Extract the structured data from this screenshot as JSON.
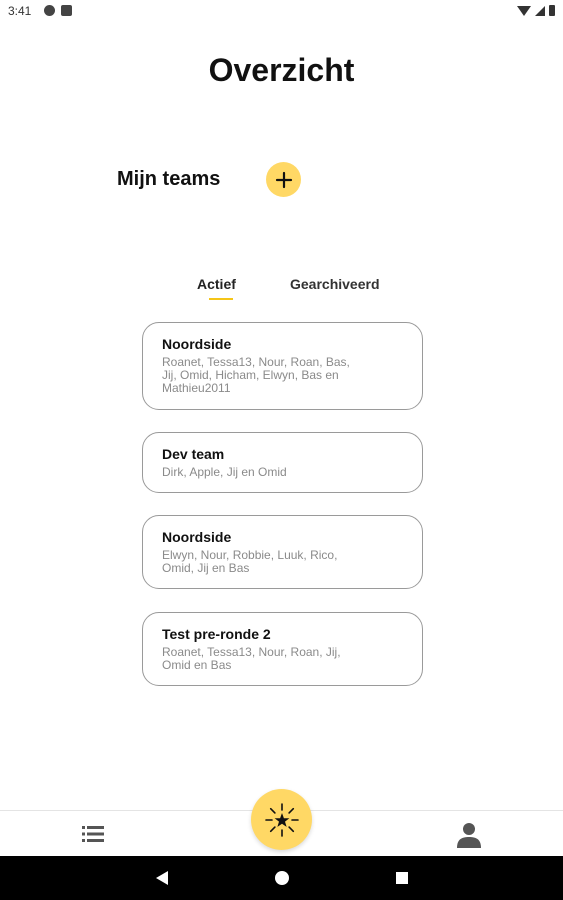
{
  "status_bar": {
    "time": "3:41",
    "left_icons": [
      "notification-icon",
      "sd-card-icon"
    ],
    "right_icons": [
      "wifi-icon",
      "signal-icon",
      "battery-icon"
    ]
  },
  "page": {
    "title": "Overzicht"
  },
  "teams": {
    "heading": "Mijn teams",
    "add_icon": "plus-icon"
  },
  "tabs": [
    {
      "label": "Actief",
      "selected": true
    },
    {
      "label": "Gearchiveerd",
      "selected": false
    }
  ],
  "team_cards": [
    {
      "name": "Noordside",
      "members": [
        "Roanet, Tessa13, Nour, Roan, Bas,",
        "Jij, Omid, Hicham, Elwyn, Bas en",
        "Mathieu2011"
      ]
    },
    {
      "name": "Dev team",
      "members": [
        "Dirk, Apple, Jij en Omid"
      ]
    },
    {
      "name": "Noordside",
      "members": [
        "Elwyn, Nour, Robbie, Luuk, Rico,",
        "Omid, Jij en Bas"
      ]
    },
    {
      "name": "Test pre-ronde 2",
      "members": [
        "Roanet, Tessa13, Nour, Roan, Jij,",
        "Omid en Bas"
      ]
    }
  ],
  "bottom_nav": {
    "left_icon": "list-icon",
    "center_icon": "star-burst-icon",
    "right_icon": "person-icon"
  },
  "system_nav": {
    "icons": [
      "back-icon",
      "home-icon",
      "recents-icon"
    ]
  },
  "colors": {
    "accent": "#ffd865",
    "tab_indicator": "#f5c518",
    "card_border": "#9a9a9a",
    "secondary_text": "#8a8a8a"
  }
}
